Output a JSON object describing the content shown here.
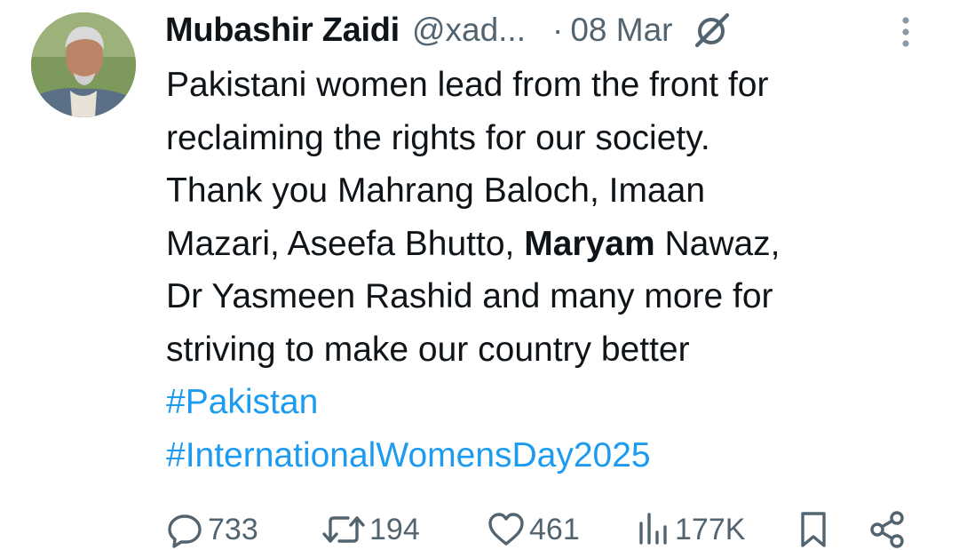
{
  "author": {
    "name": "Mubashir Zaidi",
    "handle": "@xad...",
    "separator": "·",
    "date": "08 Mar"
  },
  "tweet": {
    "lines": [
      "Pakistani women lead from the front for",
      "reclaiming the rights for our society.",
      "Thank you Mahrang Baloch, Imaan"
    ],
    "line4_before": "Mazari, Aseefa Bhutto, ",
    "line4_bold": "Maryam",
    "line4_after": " Nawaz,",
    "lines_after": [
      "Dr Yasmeen Rashid and many more for",
      "striving to make our country better"
    ],
    "hashtags": [
      "#Pakistan",
      "#InternationalWomensDay2025"
    ]
  },
  "actions": {
    "replies": "733",
    "reposts": "194",
    "likes": "461",
    "views": "177K"
  },
  "colors": {
    "text": "#0f1419",
    "muted": "#536471",
    "link": "#1d9bf0"
  },
  "icons": [
    "grok-icon",
    "more-options-icon",
    "reply-icon",
    "repost-icon",
    "like-icon",
    "views-icon",
    "bookmark-icon",
    "share-icon"
  ]
}
